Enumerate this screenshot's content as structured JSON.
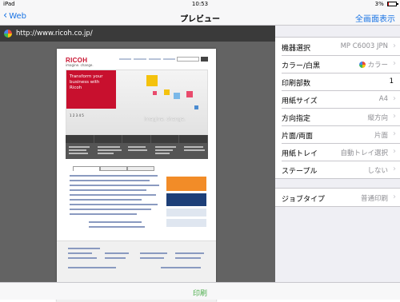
{
  "status_bar": {
    "device": "iPad",
    "time": "10:53",
    "battery": "3%",
    "battery_level": 0.03
  },
  "navbar": {
    "back_label": "Web",
    "title": "プレビュー",
    "right_label": "全画面表示"
  },
  "preview": {
    "url": "http://www.ricoh.co.jp/",
    "page": {
      "logo": "RICOH",
      "tagline": "imagine. change.",
      "hero_text": "Transform your business with Ricoh",
      "hero_pager": "1 2 3 4 5",
      "hero_slogan": "imagine. change."
    }
  },
  "settings": {
    "groups": [
      {
        "rows": [
          {
            "label": "機器選択",
            "value": "MP C6003 JPN",
            "chevron": true
          },
          {
            "label": "カラー/白黒",
            "value": "カラー",
            "chevron": true,
            "icon": "color-wheel-icon"
          },
          {
            "label": "印刷部数",
            "value": "1",
            "chevron": false
          },
          {
            "label": "用紙サイズ",
            "value": "A4",
            "chevron": true
          },
          {
            "label": "方向指定",
            "value": "縦方向",
            "chevron": true
          },
          {
            "label": "片面/両面",
            "value": "片面",
            "chevron": true
          },
          {
            "label": "用紙トレイ",
            "value": "自動トレイ選択",
            "chevron": true
          },
          {
            "label": "ステープル",
            "value": "しない",
            "chevron": true
          }
        ]
      },
      {
        "rows": [
          {
            "label": "ジョブタイプ",
            "value": "普通印刷",
            "chevron": true
          }
        ]
      }
    ]
  },
  "bottom_bar": {
    "print_label": "印刷"
  },
  "colors": {
    "accent": "#1a74e4",
    "print_green": "#4cae4c",
    "ricoh_red": "#c8102e"
  }
}
